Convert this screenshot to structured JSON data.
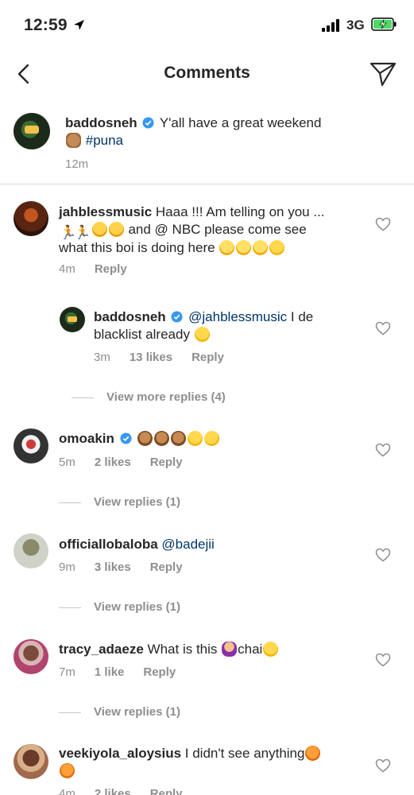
{
  "status_bar": {
    "time": "12:59",
    "network": "3G"
  },
  "header": {
    "title": "Comments"
  },
  "caption": {
    "username": "baddosneh",
    "text": "Y'all have a great weekend",
    "hashtag": "#puna",
    "time": "12m"
  },
  "comments": [
    {
      "username": "jahblessmusic",
      "text_line1": "Haaa !!! Am telling on you ...",
      "text_line2": "and @ NBC please come see",
      "text_line3": "what this boi is doing here",
      "time": "4m",
      "reply_label": "Reply"
    },
    {
      "username": "baddosneh",
      "mention": "@jahblessmusic",
      "text_line1": "I de",
      "text_line2": "blacklist already",
      "time": "3m",
      "likes": "13 likes",
      "reply_label": "Reply",
      "view_more": "View more replies (4)"
    },
    {
      "username": "omoakin",
      "time": "5m",
      "likes": "2 likes",
      "reply_label": "Reply",
      "view_replies": "View replies (1)"
    },
    {
      "username": "officiallobaloba",
      "mention": "@badejii",
      "time": "9m",
      "likes": "3 likes",
      "reply_label": "Reply",
      "view_replies": "View replies (1)"
    },
    {
      "username": "tracy_adaeze",
      "text": "What is this",
      "text_after": "chai",
      "time": "7m",
      "likes": "1 like",
      "reply_label": "Reply",
      "view_replies": "View replies (1)"
    },
    {
      "username": "veekiyola_aloysius",
      "text": "I didn't see anything",
      "time": "4m",
      "likes": "2 likes",
      "reply_label": "Reply"
    }
  ],
  "icons": {
    "back": "chevron-left-icon",
    "send": "paper-plane-icon",
    "verified": "verified-badge-icon",
    "like": "heart-outline-icon"
  },
  "colors": {
    "verified": "#3897f0",
    "link": "#003569",
    "meta": "#8e8e8e"
  }
}
